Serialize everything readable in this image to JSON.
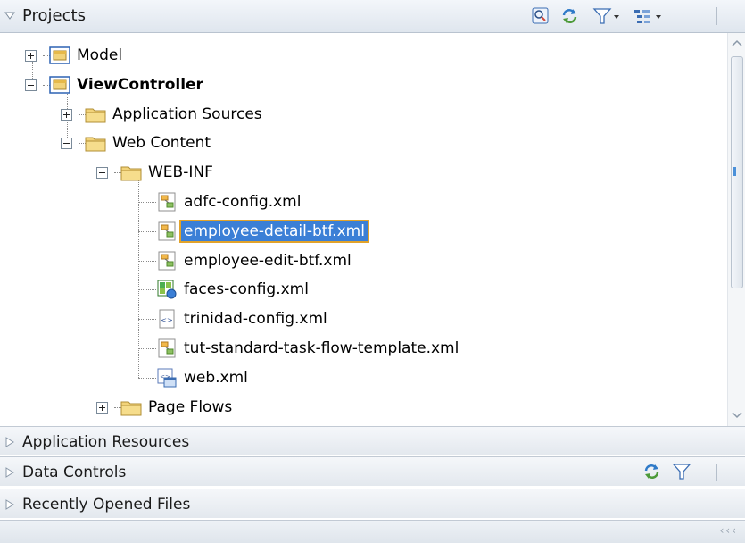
{
  "projects_panel": {
    "title": "Projects",
    "toolbar": [
      "search-project-icon",
      "sync-icon",
      "filter-icon",
      "working-sets-icon"
    ]
  },
  "tree": [
    {
      "label": "Model",
      "depth": 0,
      "icon": "project-icon",
      "expander": "plus"
    },
    {
      "label": "ViewController",
      "depth": 0,
      "icon": "project-icon",
      "expander": "minus",
      "bold": true
    },
    {
      "label": "Application Sources",
      "depth": 1,
      "icon": "folder-icon",
      "expander": "plus"
    },
    {
      "label": "Web Content",
      "depth": 1,
      "icon": "folder-icon",
      "expander": "minus"
    },
    {
      "label": "WEB-INF",
      "depth": 2,
      "icon": "folder-icon",
      "expander": "minus"
    },
    {
      "label": "adfc-config.xml",
      "depth": 3,
      "icon": "task-flow-xml-icon"
    },
    {
      "label": "employee-detail-btf.xml",
      "depth": 3,
      "icon": "task-flow-xml-icon",
      "selected": true
    },
    {
      "label": "employee-edit-btf.xml",
      "depth": 3,
      "icon": "task-flow-xml-icon"
    },
    {
      "label": "faces-config.xml",
      "depth": 3,
      "icon": "faces-config-icon"
    },
    {
      "label": "trinidad-config.xml",
      "depth": 3,
      "icon": "xml-file-icon"
    },
    {
      "label": "tut-standard-task-flow-template.xml",
      "depth": 3,
      "icon": "task-flow-xml-icon"
    },
    {
      "label": "web.xml",
      "depth": 3,
      "icon": "web-xml-icon"
    },
    {
      "label": "Page Flows",
      "depth": 2,
      "icon": "folder-icon",
      "expander": "plus"
    }
  ],
  "panes": [
    {
      "title": "Application Resources"
    },
    {
      "title": "Data Controls",
      "toolbar": [
        "sync-icon",
        "filter-icon"
      ]
    },
    {
      "title": "Recently Opened Files"
    }
  ],
  "colors": {
    "selection": "#3b7fd6",
    "selection_outline": "#e2a32a",
    "folder": "#f2d37a",
    "header_bg": "#e6ebf1"
  }
}
